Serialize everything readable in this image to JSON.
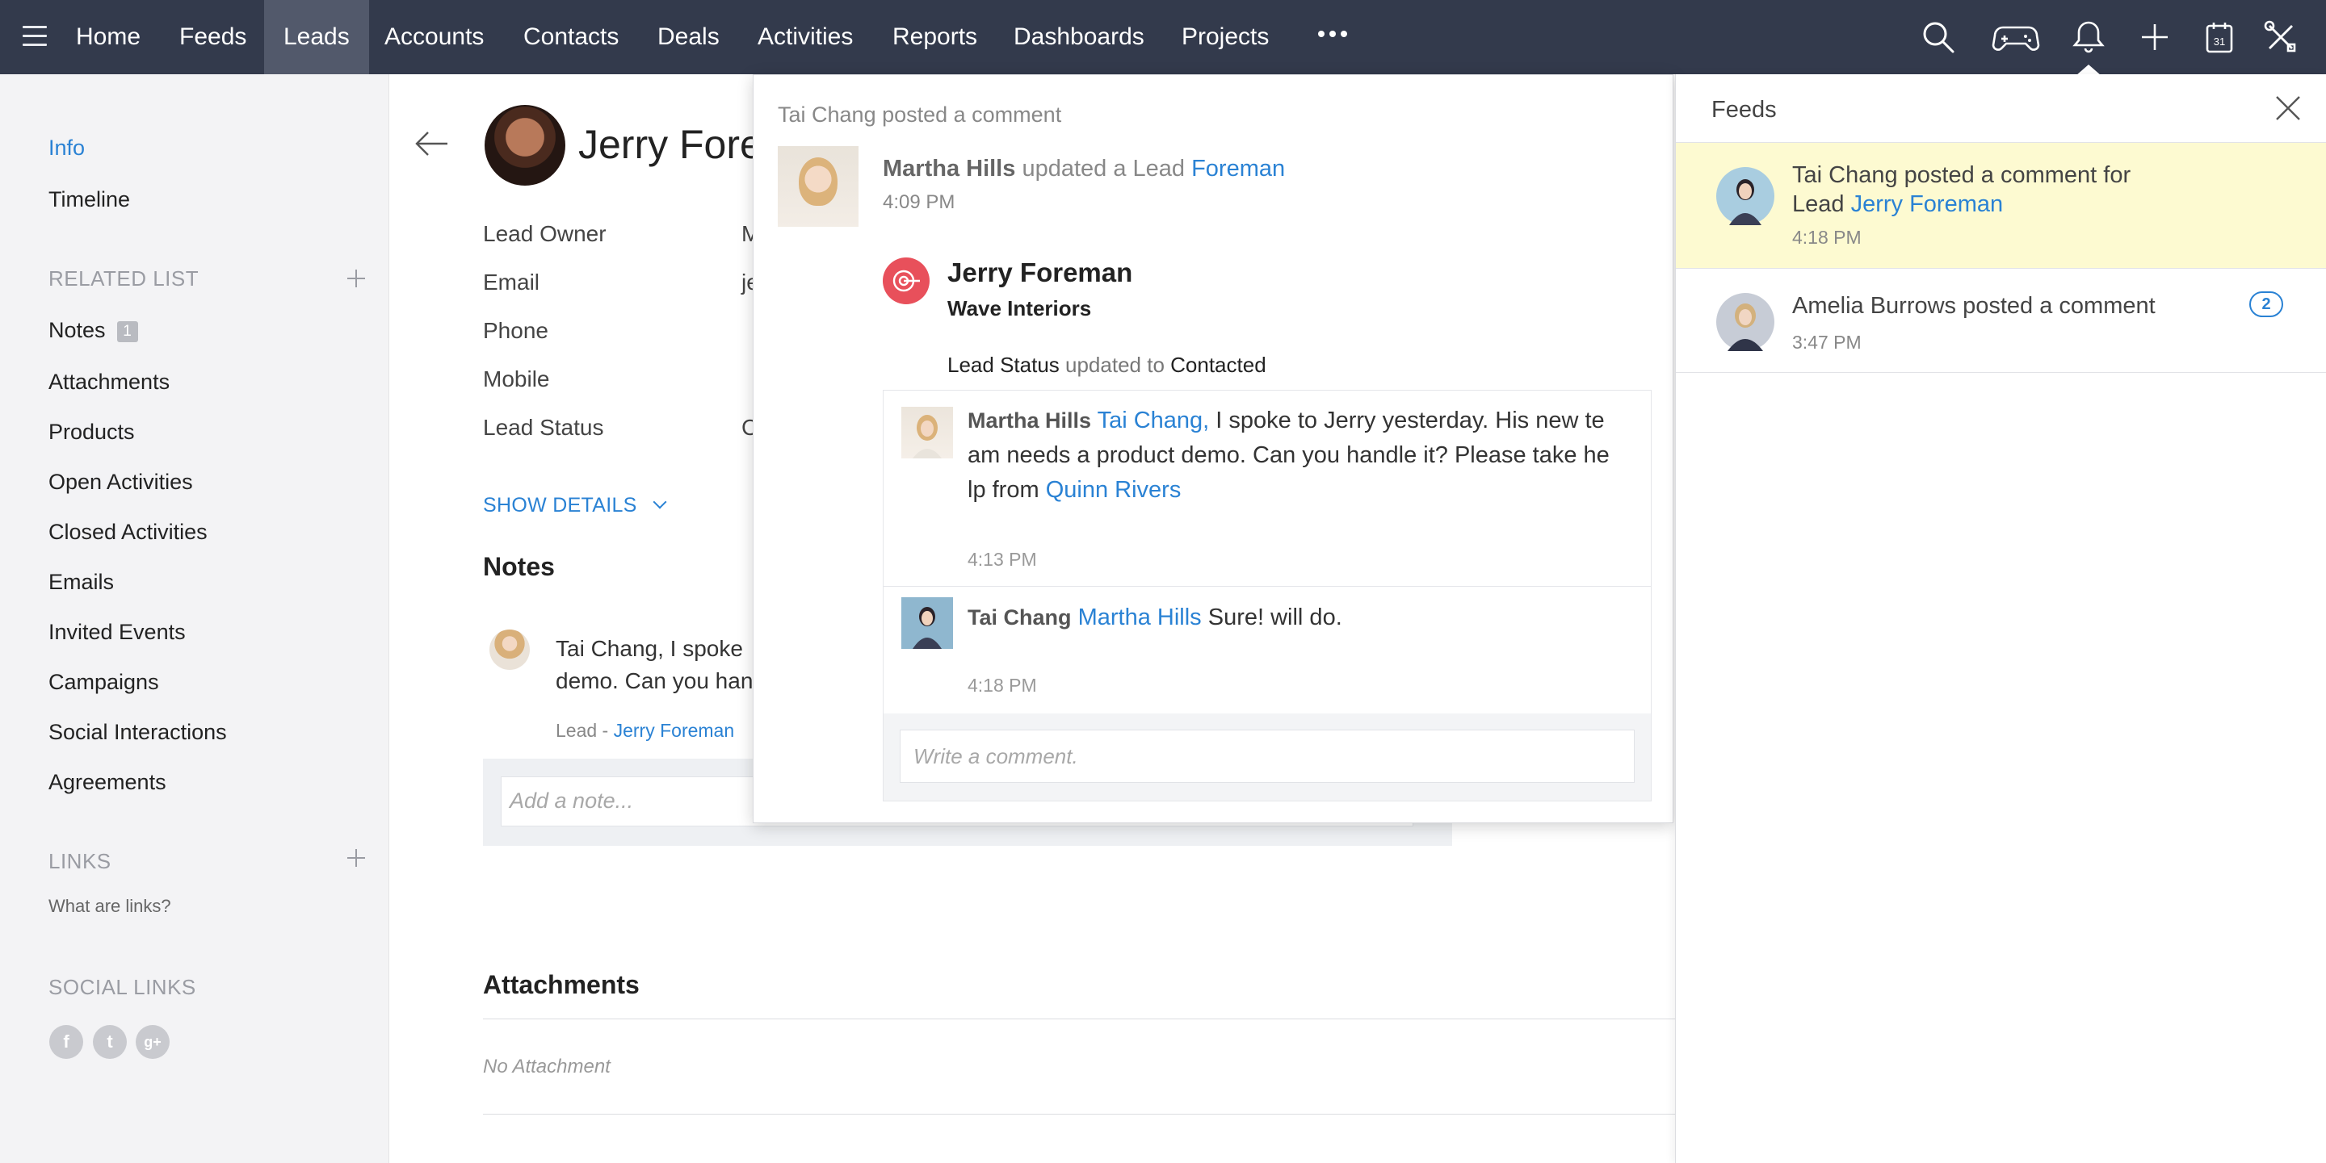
{
  "nav": {
    "items": [
      {
        "label": "Home",
        "active": false
      },
      {
        "label": "Feeds",
        "active": false
      },
      {
        "label": "Leads",
        "active": true
      },
      {
        "label": "Accounts",
        "active": false
      },
      {
        "label": "Contacts",
        "active": false
      },
      {
        "label": "Deals",
        "active": false
      },
      {
        "label": "Activities",
        "active": false
      },
      {
        "label": "Reports",
        "active": false
      },
      {
        "label": "Dashboards",
        "active": false
      },
      {
        "label": "Projects",
        "active": false
      }
    ],
    "icons": [
      "search-icon",
      "gamepad-icon",
      "bell-icon",
      "plus-icon",
      "calendar-icon",
      "tools-icon"
    ],
    "calendar_day": "31"
  },
  "sidebar": {
    "info": "Info",
    "timeline": "Timeline",
    "related_list_title": "RELATED LIST",
    "related": [
      {
        "label": "Notes",
        "badge": "1"
      },
      {
        "label": "Attachments"
      },
      {
        "label": "Products"
      },
      {
        "label": "Open Activities"
      },
      {
        "label": "Closed Activities"
      },
      {
        "label": "Emails"
      },
      {
        "label": "Invited Events"
      },
      {
        "label": "Campaigns"
      },
      {
        "label": "Social Interactions"
      },
      {
        "label": "Agreements"
      }
    ],
    "links_title": "LINKS",
    "links_help": "What are links?",
    "social_links_title": "SOCIAL LINKS",
    "social_icons": [
      "facebook-icon",
      "twitter-icon",
      "google-plus-icon"
    ]
  },
  "record": {
    "title": "Jerry Fore",
    "fields": [
      {
        "label": "Lead Owner",
        "value": "M"
      },
      {
        "label": "Email",
        "value": "je"
      },
      {
        "label": "Phone",
        "value": ""
      },
      {
        "label": "Mobile",
        "value": ""
      },
      {
        "label": "Lead Status",
        "value": "C"
      }
    ],
    "show_details": "SHOW DETAILS",
    "notes_title": "Notes",
    "note": {
      "line1": "Tai Chang,  I spoke",
      "line2": "demo. Can you han",
      "meta_prefix": "Lead  -",
      "meta_link": "Jerry Foreman"
    },
    "add_note_placeholder": "Add a note...",
    "attachments_title": "Attachments",
    "no_attachment": "No Attachment"
  },
  "popup": {
    "header": "Tai Chang posted a comment",
    "actor": "Martha Hills",
    "action": "updated a Lead",
    "lead_link": "Foreman",
    "time": "4:09 PM",
    "lead_name": "Jerry Foreman",
    "lead_company": "Wave Interiors",
    "status_field": "Lead Status",
    "status_mid": "updated to",
    "status_value": "Contacted",
    "comments": [
      {
        "author": "Martha Hills",
        "mention": "Tai Chang,",
        "line1": "  I spoke to Jerry yesterday. His new te",
        "line2": "am needs a product demo. Can you handle it? Please take he",
        "line3_prefix": "lp from",
        "line3_link": "Quinn Rivers",
        "time": "4:13 PM"
      },
      {
        "author": "Tai Chang",
        "mention": "Martha Hills",
        "text": "Sure! will do.",
        "time": "4:18 PM"
      }
    ],
    "comment_placeholder": "Write a comment."
  },
  "feeds": {
    "title": "Feeds",
    "items": [
      {
        "line1": "Tai Chang posted a comment for",
        "line2_prefix": "Lead",
        "line2_link": "Jerry Foreman",
        "time": "4:18 PM",
        "highlighted": true
      },
      {
        "line1": "Amelia Burrows posted a comment",
        "time": "3:47 PM",
        "count": "2",
        "highlighted": false
      }
    ]
  },
  "colors": {
    "nav_bg": "#333a4c",
    "nav_active": "#52596b",
    "link": "#2a82d4",
    "feed_highlight": "#fdfad1",
    "lead_icon": "#e8505b"
  }
}
